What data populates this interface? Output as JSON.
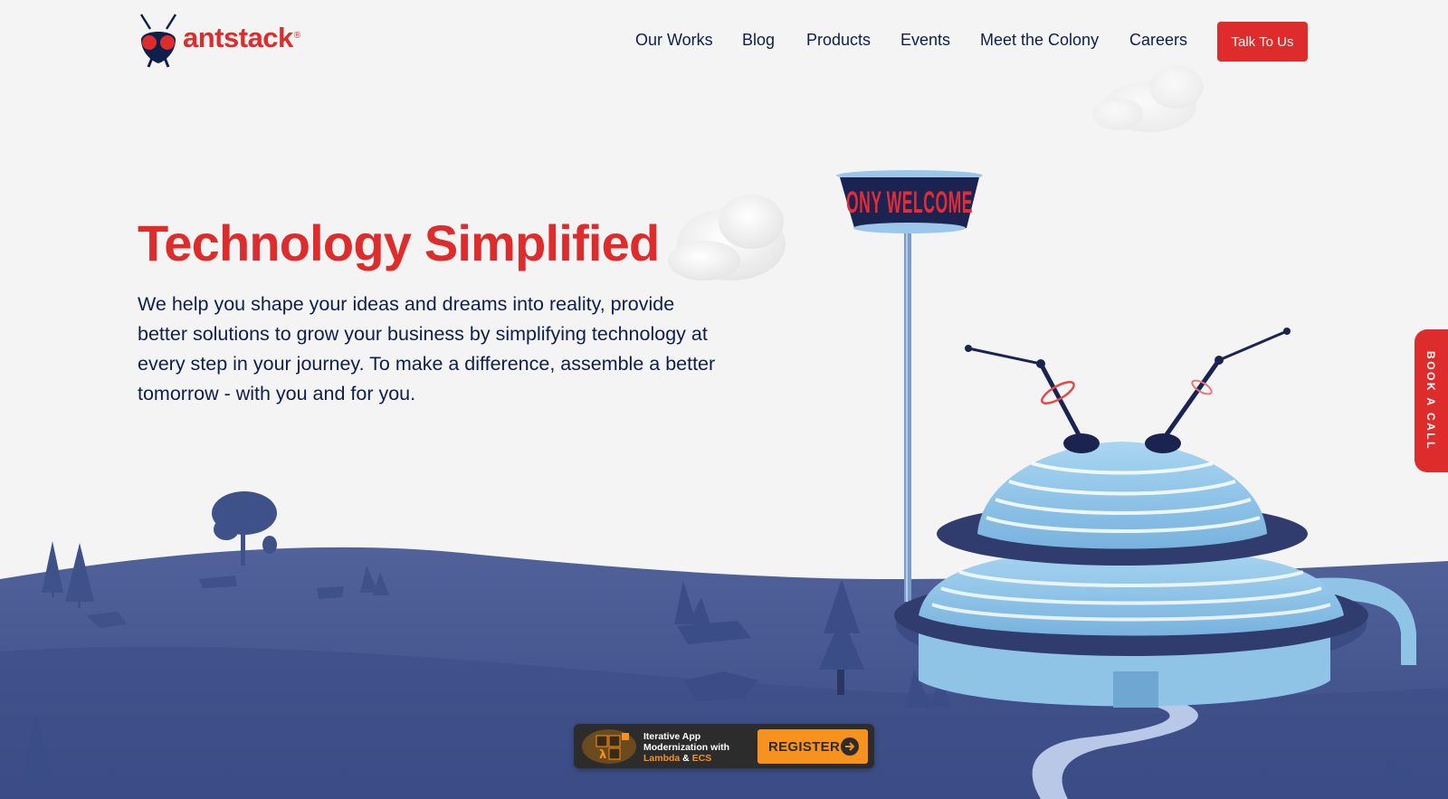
{
  "brand": {
    "name": "antstack",
    "registered_mark": "®",
    "logo_icon": "ant-head-icon",
    "primary_color": "#de2b2b",
    "navy_color": "#0f1f4b"
  },
  "nav": {
    "items": [
      {
        "label": "Our Works"
      },
      {
        "label": "Blog"
      },
      {
        "label": "Products"
      },
      {
        "label": "Events"
      },
      {
        "label": "Meet the Colony"
      },
      {
        "label": "Careers"
      }
    ],
    "cta_label": "Talk To Us"
  },
  "hero": {
    "title": "Technology Simplified",
    "description": "We help you shape your ideas and dreams into reality, provide better solutions to grow your business by simplifying technology at every step in your journey. To make a difference, assemble a better tomorrow - with you and for you.",
    "sign_text": "ONY WELCOME",
    "scene_colors": {
      "ground": "#44558e",
      "building": "#8fc4e6",
      "sky": "#f4f4f4"
    }
  },
  "side_tab": {
    "label": "BOOK A CALL"
  },
  "promo": {
    "line1": "Iterative App",
    "line2": "Modernization with",
    "accent1": "Lambda",
    "joiner": " & ",
    "accent2": "ECS",
    "register_label": "REGISTER",
    "arrow_icon": "arrow-right-icon",
    "accent_color": "#f7921e"
  }
}
